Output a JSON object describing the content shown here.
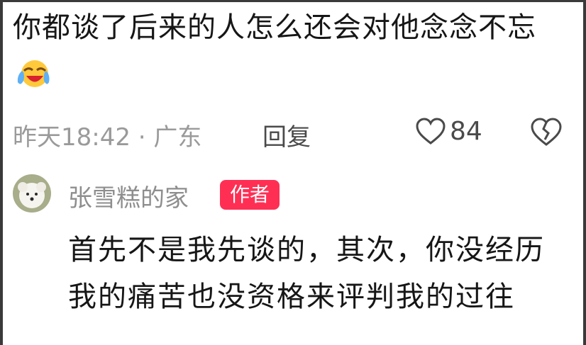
{
  "comment": {
    "text": "你都谈了后来的人怎么还会对他念念不忘",
    "emoji": "loudly-crying-laughing-emoji",
    "time_location": "昨天18:42 · 广东",
    "reply_label": "回复",
    "likes": "84"
  },
  "reply": {
    "author": "张雪糕的家",
    "badge": "作者",
    "text": "首先不是我先谈的，其次，你没经历我的痛苦也没资格来评判我的过往"
  },
  "icons": {
    "like": "heart-outline-icon",
    "dislike": "broken-heart-icon",
    "avatar": "white-dog-avatar"
  },
  "colors": {
    "text_primary": "#161616",
    "text_secondary": "#9a9a9a",
    "badge_bg": "#ff2f54",
    "badge_text": "#ffffff"
  }
}
